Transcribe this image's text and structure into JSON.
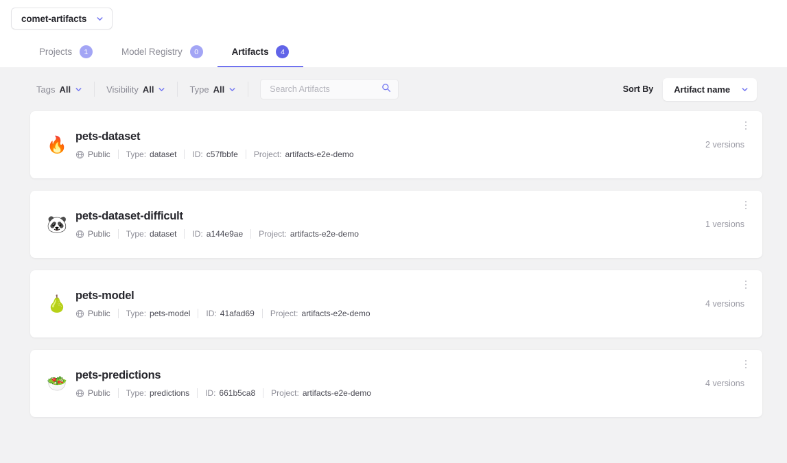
{
  "header": {
    "workspace": {
      "name": "comet-artifacts",
      "chevron_icon": "chevron-down-icon"
    },
    "tabs": [
      {
        "label": "Projects",
        "count": "1",
        "active": false
      },
      {
        "label": "Model Registry",
        "count": "0",
        "active": false
      },
      {
        "label": "Artifacts",
        "count": "4",
        "active": true
      }
    ]
  },
  "toolbar": {
    "filters": [
      {
        "name": "Tags",
        "value": "All"
      },
      {
        "name": "Visibility",
        "value": "All"
      },
      {
        "name": "Type",
        "value": "All"
      }
    ],
    "search": {
      "placeholder": "Search Artifacts",
      "value": "",
      "icon": "search-icon"
    },
    "sort": {
      "label": "Sort By",
      "value": "Artifact name",
      "icon": "chevron-down-icon"
    }
  },
  "artifacts": [
    {
      "emoji": "🔥",
      "emoji_name": "fire-emoji",
      "name": "pets-dataset",
      "visibility": "Public",
      "type_label": "Type:",
      "type_value": "dataset",
      "id_label": "ID:",
      "id_value": "c57fbbfe",
      "project_label": "Project:",
      "project_value": "artifacts-e2e-demo",
      "versions": "2 versions"
    },
    {
      "emoji": "🐼",
      "emoji_name": "panda-emoji",
      "name": "pets-dataset-difficult",
      "visibility": "Public",
      "type_label": "Type:",
      "type_value": "dataset",
      "id_label": "ID:",
      "id_value": "a144e9ae",
      "project_label": "Project:",
      "project_value": "artifacts-e2e-demo",
      "versions": "1 versions"
    },
    {
      "emoji": "🍐",
      "emoji_name": "pear-emoji",
      "name": "pets-model",
      "visibility": "Public",
      "type_label": "Type:",
      "type_value": "pets-model",
      "id_label": "ID:",
      "id_value": "41afad69",
      "project_label": "Project:",
      "project_value": "artifacts-e2e-demo",
      "versions": "4 versions"
    },
    {
      "emoji": "🥗",
      "emoji_name": "salad-emoji",
      "name": "pets-predictions",
      "visibility": "Public",
      "type_label": "Type:",
      "type_value": "predictions",
      "id_label": "ID:",
      "id_value": "661b5ca8",
      "project_label": "Project:",
      "project_value": "artifacts-e2e-demo",
      "versions": "4 versions"
    }
  ],
  "colors": {
    "accent": "#6164e8",
    "accent_light": "#a3a5f5",
    "page_bg": "#f2f2f3",
    "card_bg": "#ffffff",
    "text_primary": "#26262c",
    "text_muted": "#8c8c96"
  }
}
